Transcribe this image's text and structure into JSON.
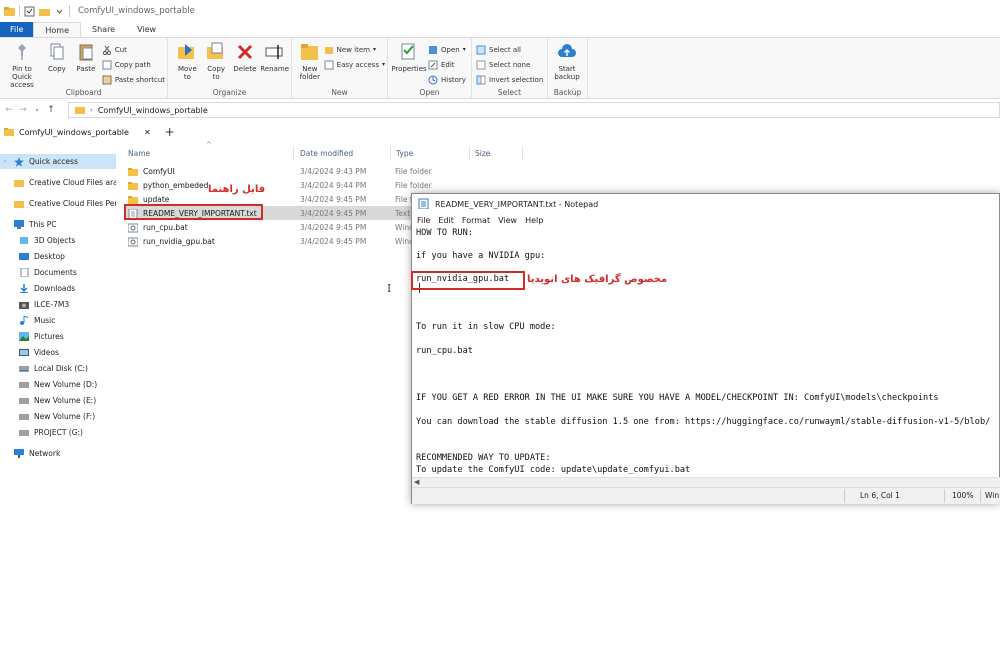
{
  "window": {
    "title": "ComfyUI_windows_portable"
  },
  "ribbon_tabs": [
    "File",
    "Home",
    "Share",
    "View"
  ],
  "ribbon": {
    "clipboard": {
      "name": "Clipboard",
      "pin": "Pin to Quick access",
      "copy": "Copy",
      "paste": "Paste",
      "cut": "Cut",
      "copy_path": "Copy path",
      "paste_shortcut": "Paste shortcut"
    },
    "organize": {
      "name": "Organize",
      "move_to": "Move to",
      "copy_to": "Copy to",
      "delete": "Delete",
      "rename": "Rename"
    },
    "new": {
      "name": "New",
      "new_folder": "New folder",
      "new_item": "New item",
      "easy_access": "Easy access"
    },
    "open": {
      "name": "Open",
      "properties": "Properties",
      "open": "Open",
      "edit": "Edit",
      "history": "History"
    },
    "select": {
      "name": "Select",
      "select_all": "Select all",
      "select_none": "Select none",
      "invert_selection": "Invert selection"
    },
    "backup": {
      "name": "Backup",
      "start_backup": "Start backup"
    }
  },
  "address": {
    "path": "ComfyUI_windows_portable"
  },
  "folder_tab": {
    "label": "ComfyUI_windows_portable"
  },
  "nav": {
    "quick_access": "Quick access",
    "items": [
      "Creative Cloud Files  aras",
      "Creative Cloud Files Pers",
      "This PC",
      "3D Objects",
      "Desktop",
      "Documents",
      "Downloads",
      "ILCE-7M3",
      "Music",
      "Pictures",
      "Videos",
      "Local Disk (C:)",
      "New Volume (D:)",
      "New Volume (E:)",
      "New Volume (F:)",
      "PROJECT (G:)",
      "Network"
    ]
  },
  "columns": {
    "name": "Name",
    "date": "Date modified",
    "type": "Type",
    "size": "Size"
  },
  "files": [
    {
      "name": "ComfyUI",
      "date": "3/4/2024 9:43 PM",
      "type": "File folder"
    },
    {
      "name": "python_embeded",
      "date": "3/4/2024 9:44 PM",
      "type": "File folder"
    },
    {
      "name": "update",
      "date": "3/4/2024 9:45 PM",
      "type": "File fo"
    },
    {
      "name": "README_VERY_IMPORTANT.txt",
      "date": "3/4/2024 9:45 PM",
      "type": "Text"
    },
    {
      "name": "run_cpu.bat",
      "date": "3/4/2024 9:45 PM",
      "type": "Wind"
    },
    {
      "name": "run_nvidia_gpu.bat",
      "date": "3/4/2024 9:45 PM",
      "type": "Wind"
    }
  ],
  "annotations": {
    "guide_file": "فایل راهنما",
    "nvidia_note": "مخصوص گرافیک های انویدیا"
  },
  "notepad": {
    "title": "README_VERY_IMPORTANT.txt - Notepad",
    "menu": [
      "File",
      "Edit",
      "Format",
      "View",
      "Help"
    ],
    "lines": [
      "HOW TO RUN:",
      "if you have a NVIDIA gpu:",
      "run_nvidia_gpu.bat",
      "To run it in slow CPU mode:",
      "run_cpu.bat",
      "IF YOU GET A RED ERROR IN THE UI MAKE SURE YOU HAVE A MODEL/CHECKPOINT IN: ComfyUI\\models\\checkpoints",
      "You can download the stable diffusion 1.5 one from: https://huggingface.co/runwayml/stable-diffusion-v1-5/blob/",
      "RECOMMENDED WAY TO UPDATE:",
      "To update the ComfyUI code: update\\update_comfyui.bat"
    ],
    "status": {
      "position": "Ln 6, Col 1",
      "zoom": "100%",
      "encoding": "Win"
    }
  },
  "colors": {
    "accent": "#1565c0",
    "annotation": "#d32a2a",
    "selection": "#cce4f7",
    "folder": "#f3c04a"
  }
}
